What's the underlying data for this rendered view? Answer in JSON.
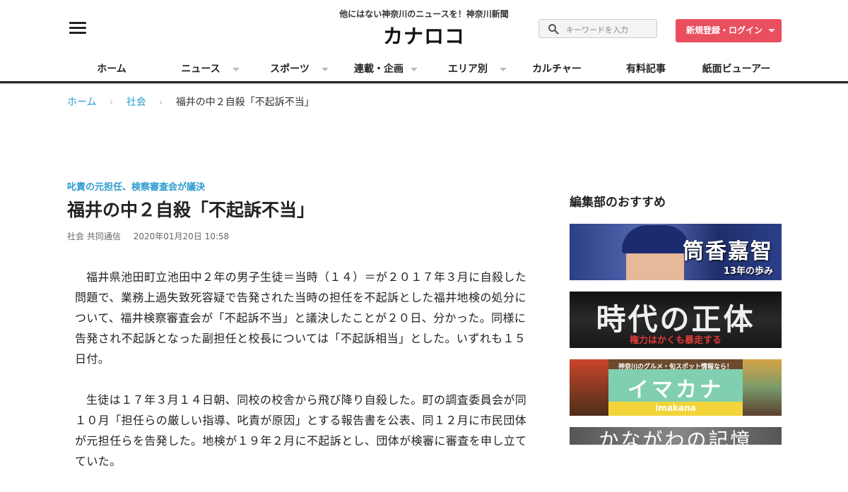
{
  "header": {
    "tagline": "他にはない神奈川のニュースを！神奈川新聞",
    "logo": "カナロコ",
    "search": {
      "placeholder": "キーワードを入力"
    },
    "login_label": "新規登録・ログイン"
  },
  "nav": {
    "items": [
      {
        "label": "ホーム"
      },
      {
        "label": "ニュース"
      },
      {
        "label": "スポーツ"
      },
      {
        "label": "連載・企画"
      },
      {
        "label": "エリア別"
      },
      {
        "label": "カルチャー"
      },
      {
        "label": "有料記事"
      },
      {
        "label": "紙面ビューアー"
      }
    ]
  },
  "breadcrumb": {
    "items": [
      "ホーム",
      "社会"
    ],
    "current": "福井の中２自殺「不起訴不当」"
  },
  "article": {
    "kicker": "叱責の元担任、検察審査会が議決",
    "title": "福井の中２自殺「不起訴不当」",
    "category": "社会",
    "source": "共同通信",
    "date": "2020年01月20日 10:58",
    "paragraphs": [
      "福井県池田町立池田中２年の男子生徒＝当時（１４）＝が２０１７年３月に自殺した問題で、業務上過失致死容疑で告発された当時の担任を不起訴とした福井地検の処分について、福井検察審査会が「不起訴不当」と議決したことが２０日、分かった。同様に告発され不起訴となった副担任と校長については「不起訴相当」とした。いずれも１５日付。",
      "生徒は１７年３月１４日朝、同校の校舎から飛び降り自殺した。町の調査委員会が同１０月「担任らの厳しい指導、叱責が原因」とする報告書を公表、同１２月に市民団体が元担任らを告発した。地検が１９年２月に不起訴とし、団体が検審に審査を申し立てていた。"
    ]
  },
  "sidebar": {
    "title": "編集部のおすすめ",
    "banners": [
      {
        "main": "筒香嘉智",
        "sub": "13年の歩み"
      },
      {
        "main": "時代の正体",
        "sub": "権力はかくも暴走する"
      },
      {
        "top": "神奈川のグルメ・旬スポット情報なら！",
        "main": "イマカナ",
        "sub": "imakana"
      },
      {
        "main": "かながわの記憶"
      }
    ]
  }
}
